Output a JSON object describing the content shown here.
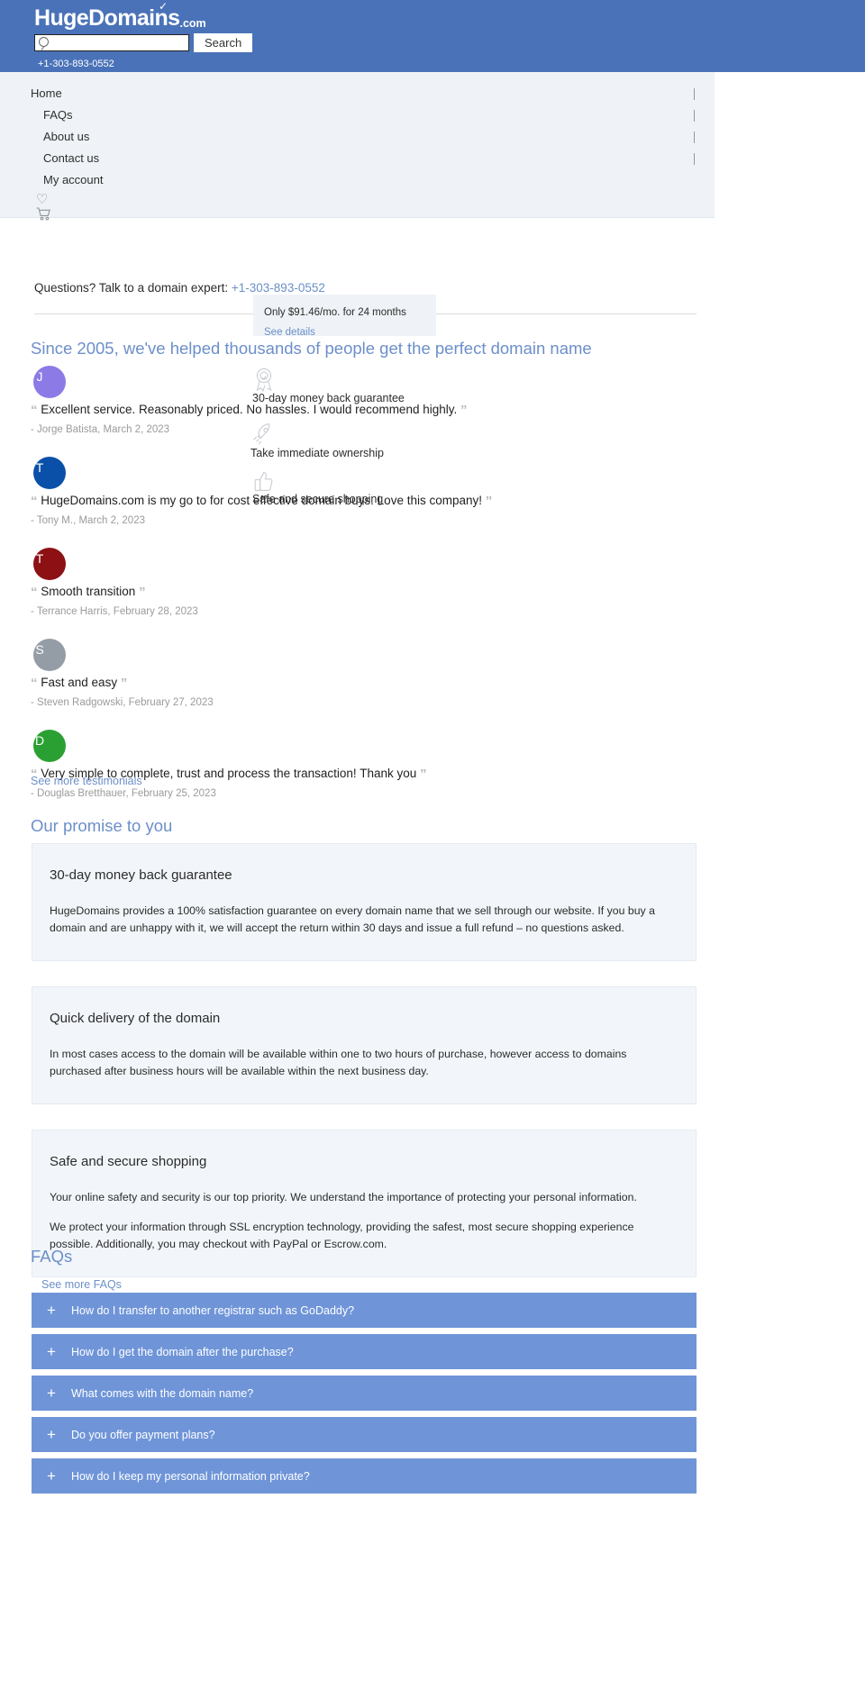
{
  "header": {
    "logo_main": "HugeDomains",
    "logo_check": "✓",
    "logo_tld": ".com",
    "search_placeholder": "",
    "search_value": "",
    "search_button": "Search",
    "phone": "+1-303-893-0552",
    "bg_color": "#4a72b8"
  },
  "nav": {
    "items": [
      {
        "label": "Home",
        "sub": false
      },
      {
        "label": "FAQs",
        "sub": true
      },
      {
        "label": "About us",
        "sub": true
      },
      {
        "label": "Contact us",
        "sub": true
      },
      {
        "label": "My account",
        "sub": true
      }
    ],
    "wishlist_icon": "♡",
    "cart_icon": "Ὥ2"
  },
  "questions": {
    "text": "Questions? Talk to a domain expert:",
    "phone": "+1-303-893-0552"
  },
  "installment": {
    "text": "Only $91.46/mo. for 24 months",
    "link": "See details",
    "price_per_month": "$91.46",
    "months": "24"
  },
  "testimonials_section": {
    "heading": "Since 2005, we've helped thousands of people get the perfect domain name",
    "see_more": "See more testimonials",
    "open_quote": "“",
    "close_quote": "”",
    "items": [
      {
        "initial": "J",
        "avatar_color": "#8c7ae6",
        "quote": "Excellent service. Reasonably priced. No hassles. I would recommend highly.",
        "author": "- Jorge Batista, March 2, 2023"
      },
      {
        "initial": "T",
        "avatar_color": "#0b50a8",
        "quote": "HugeDomains.com is my go to for cost effective domain buys. Love this company!",
        "author": "- Tony M., March 2, 2023"
      },
      {
        "initial": "T",
        "avatar_color": "#8d1014",
        "quote": "Smooth transition",
        "author": "- Terrance Harris, February 28, 2023"
      },
      {
        "initial": "S",
        "avatar_color": "#949ca6",
        "quote": "Fast and easy",
        "author": "- Steven Radgowski, February 27, 2023"
      },
      {
        "initial": "D",
        "avatar_color": "#2ba032",
        "quote": "Very simple to complete, trust and process the transaction! Thank you",
        "author": "- Douglas Bretthauer, February 25, 2023"
      }
    ]
  },
  "trust_badges": [
    {
      "icon": "award-ribbon-icon",
      "label": "30-day money back guarantee"
    },
    {
      "icon": "rocket-icon",
      "label": "Take immediate ownership"
    },
    {
      "icon": "thumbs-up-icon",
      "label": "Safe and secure shopping"
    }
  ],
  "promise": {
    "heading": "Our promise to you",
    "cards": [
      {
        "title": "30-day money back guarantee",
        "paragraphs": [
          "HugeDomains provides a 100% satisfaction guarantee on every domain name that we sell through our website. If you buy a domain and are unhappy with it, we will accept the return within 30 days and issue a full refund – no questions asked."
        ]
      },
      {
        "title": "Quick delivery of the domain",
        "paragraphs": [
          "In most cases access to the domain will be available within one to two hours of purchase, however access to domains purchased after business hours will be available within the next business day."
        ]
      },
      {
        "title": "Safe and secure shopping",
        "paragraphs": [
          "Your online safety and security is our top priority. We understand the importance of protecting your personal information.",
          "We protect your information through SSL encryption technology, providing the safest, most secure shopping experience possible. Additionally, you may checkout with PayPal or Escrow.com."
        ]
      }
    ]
  },
  "faq": {
    "heading": "FAQs",
    "see_more": "See more FAQs",
    "expand_icon": "+",
    "items": [
      {
        "question": "How do I transfer to another registrar such as GoDaddy?"
      },
      {
        "question": "How do I get the domain after the purchase?"
      },
      {
        "question": "What comes with the domain name?"
      },
      {
        "question": "Do you offer payment plans?"
      },
      {
        "question": "How do I keep my personal information private?"
      }
    ],
    "bar_color": "#6f95d8"
  }
}
